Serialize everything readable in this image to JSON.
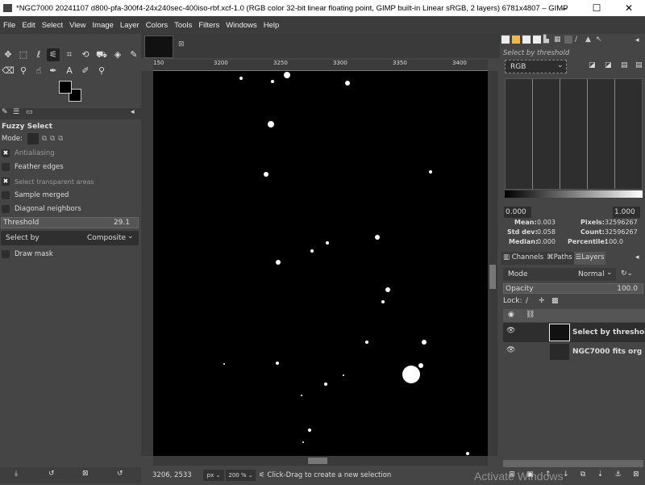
{
  "window": {
    "title": "*NGC7000 20241107 d800-pfa-300f4-24x240sec-400iso-rbf.xcf-1.0 (RGB color 32-bit linear floating point, GIMP built-in Linear sRGB, 2 layers) 6781x4807 – GIMP",
    "minimize": "–",
    "maximize": "☐",
    "close": "✕"
  },
  "menu": [
    "File",
    "Edit",
    "Select",
    "View",
    "Image",
    "Layer",
    "Colors",
    "Tools",
    "Filters",
    "Windows",
    "Help"
  ],
  "tool_options": {
    "title": "Fuzzy Select",
    "mode_label": "Mode:",
    "antialiasing": "Antialiasing",
    "feather": "Feather edges",
    "select_transparent": "Select transparent areas",
    "sample_merged": "Sample merged",
    "diagonal": "Diagonal neighbors",
    "threshold_label": "Threshold",
    "threshold_value": "29.1",
    "select_by_label": "Select by",
    "select_by_value": "Composite",
    "draw_mask": "Draw mask",
    "checked": {
      "antialiasing": true,
      "feather": false,
      "select_transparent": true,
      "sample_merged": false,
      "diagonal": false,
      "draw_mask": false
    }
  },
  "ruler": {
    "h_labels": [
      "150",
      "3200",
      "3250",
      "3300",
      "3350",
      "3400"
    ]
  },
  "status": {
    "coords": "3206, 2533",
    "unit": "px",
    "zoom": "200 %",
    "message": "Click-Drag to create a new selection"
  },
  "watermark": "Activate Windows",
  "histogram": {
    "title": "Select by threshold",
    "channel": "RGB",
    "range_min": "0.000",
    "range_max": "1.000",
    "mean_label": "Mean:",
    "mean": "0.003",
    "std_label": "Std dev:",
    "std": "0.058",
    "median_label": "Median:",
    "median": "0.000",
    "pixels_label": "Pixels:",
    "pixels": "32596267",
    "count_label": "Count:",
    "count": "32596267",
    "percentile_label": "Percentile:",
    "percentile": "100.0"
  },
  "layers_panel": {
    "tabs": [
      "Channels",
      "Paths",
      "Layers"
    ],
    "mode_label": "Mode",
    "mode_value": "Normal",
    "opacity_label": "Opacity",
    "opacity_value": "100.0",
    "lock_label": "Lock:",
    "layers": [
      {
        "name": "Select by threshold",
        "visible": true,
        "active": true
      },
      {
        "name": "NGC7000 fits org",
        "visible": true,
        "active": false
      }
    ]
  }
}
